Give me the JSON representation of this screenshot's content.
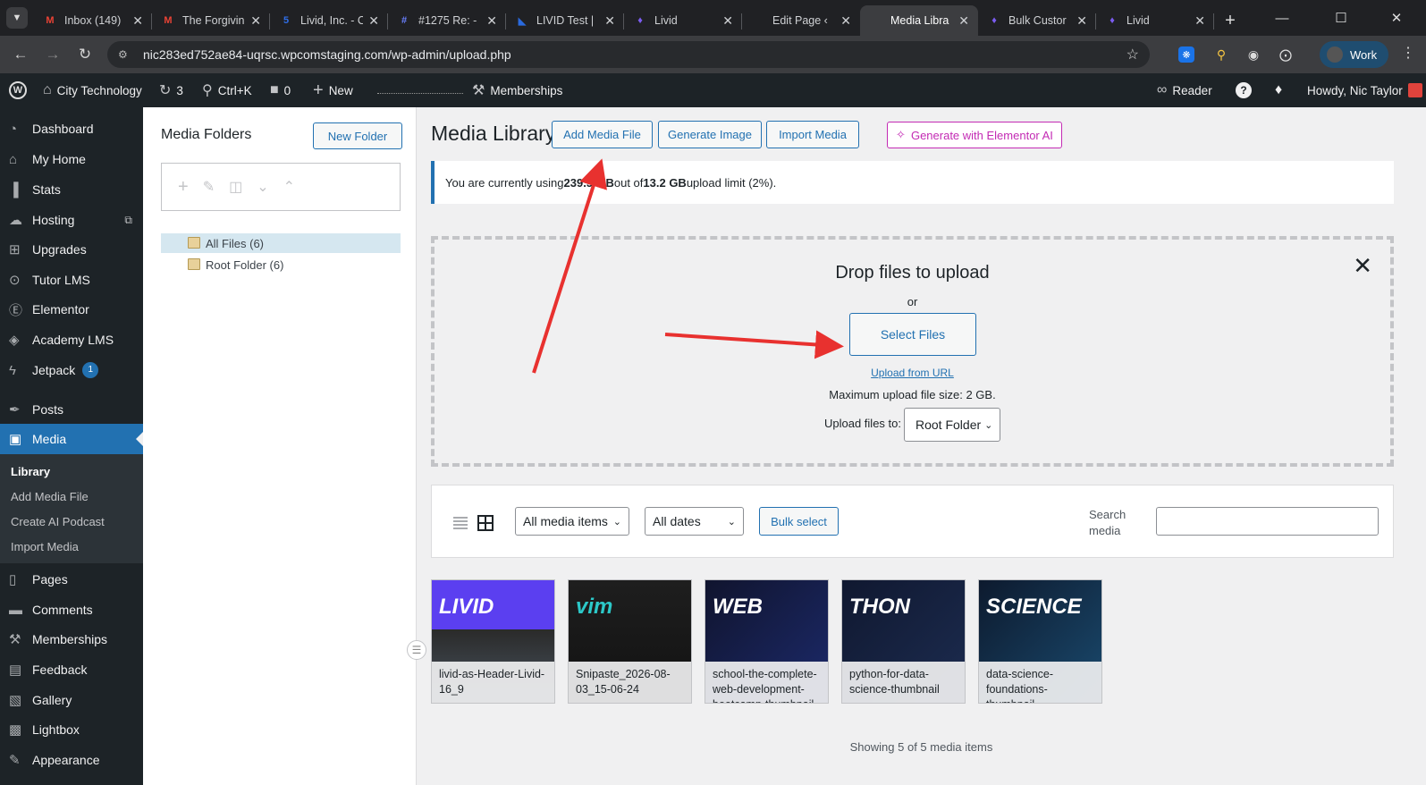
{
  "browser": {
    "tabs": [
      {
        "title": "Inbox (149)",
        "icon": "gmail-icon",
        "fav": "M",
        "fav_color": "#ea4335"
      },
      {
        "title": "The Forgivin",
        "icon": "gmail-icon",
        "fav": "M",
        "fav_color": "#ea4335"
      },
      {
        "title": "Livid, Inc. - C",
        "icon": "app-icon",
        "fav": "5",
        "fav_color": "#2f6ee8"
      },
      {
        "title": "#1275 Re: -",
        "icon": "hash-icon",
        "fav": "#",
        "fav_color": "#6a80ff"
      },
      {
        "title": "LIVID Test |",
        "icon": "app-icon",
        "fav": "◣",
        "fav_color": "#2a6ade"
      },
      {
        "title": "Livid",
        "icon": "flame-icon",
        "fav": "♦",
        "fav_color": "#7b5cf0"
      },
      {
        "title": "Edit Page ‹",
        "icon": "",
        "fav": "",
        "fav_color": "#202124"
      },
      {
        "title": "Media Libra",
        "icon": "",
        "fav": "",
        "fav_color": "#3c3d40"
      },
      {
        "title": "Bulk Custor",
        "icon": "flame-icon",
        "fav": "♦",
        "fav_color": "#7b5cf0"
      },
      {
        "title": "Livid",
        "icon": "flame-icon",
        "fav": "♦",
        "fav_color": "#7b5cf0"
      }
    ],
    "url": "nic283ed752ae84-uqrsc.wpcomstaging.com/wp-admin/upload.php",
    "profile": "Work"
  },
  "adminbar": {
    "site": "City Technology",
    "updates": "3",
    "search": "Ctrl+K",
    "comments": "0",
    "new": "New",
    "memberships": "Memberships",
    "reader": "Reader",
    "howdy": "Howdy, Nic Taylor"
  },
  "sidebar": {
    "items": [
      {
        "label": "Dashboard",
        "icon": "dashboard-icon",
        "glyph": "◔"
      },
      {
        "label": "My Home",
        "icon": "home-icon",
        "glyph": "⌂"
      },
      {
        "label": "Stats",
        "icon": "stats-icon",
        "glyph": "▐"
      },
      {
        "label": "Hosting",
        "icon": "cloud-icon",
        "glyph": "☁"
      },
      {
        "label": "Upgrades",
        "icon": "cart-icon",
        "glyph": "⊞"
      },
      {
        "label": "Tutor LMS",
        "icon": "tutor-icon",
        "glyph": "⊙"
      },
      {
        "label": "Elementor",
        "icon": "elementor-icon",
        "glyph": "Ⓔ"
      },
      {
        "label": "Academy LMS",
        "icon": "academy-icon",
        "glyph": "◈"
      },
      {
        "label": "Jetpack",
        "icon": "jetpack-icon",
        "glyph": "ϟ",
        "badge": "1"
      },
      {
        "label": "Posts",
        "icon": "pin-icon",
        "glyph": "✒"
      },
      {
        "label": "Media",
        "icon": "media-icon",
        "glyph": "▣"
      },
      {
        "label": "Pages",
        "icon": "pages-icon",
        "glyph": "▯"
      },
      {
        "label": "Comments",
        "icon": "comments-icon",
        "glyph": "▬"
      },
      {
        "label": "Memberships",
        "icon": "memberships-icon",
        "glyph": "⚒"
      },
      {
        "label": "Feedback",
        "icon": "feedback-icon",
        "glyph": "▤"
      },
      {
        "label": "Gallery",
        "icon": "gallery-icon",
        "glyph": "▧"
      },
      {
        "label": "Lightbox",
        "icon": "lightbox-icon",
        "glyph": "▩"
      },
      {
        "label": "Appearance",
        "icon": "appearance-icon",
        "glyph": "✎"
      }
    ],
    "submenu": [
      "Library",
      "Add Media File",
      "Create AI Podcast",
      "Import Media"
    ]
  },
  "folders": {
    "title": "Media Folders",
    "new_folder": "New Folder",
    "items": [
      "All Files (6)",
      "Root Folder (6)"
    ]
  },
  "main": {
    "title": "Media Library",
    "buttons": {
      "add": "Add Media File",
      "generate": "Generate Image",
      "import": "Import Media",
      "ai": "Generate with Elementor AI"
    },
    "notice": {
      "pre": "You are currently using ",
      "used": "239.5 MB",
      "mid": " out of ",
      "limit": "13.2 GB",
      "post": " upload limit (2%)."
    },
    "upload": {
      "title": "Drop files to upload",
      "or": "or",
      "select": "Select Files",
      "url": "Upload from URL",
      "max": "Maximum upload file size: 2 GB.",
      "to_label": "Upload files to:",
      "to_value": "Root Folder"
    },
    "filters": {
      "type": "All media items",
      "dates": "All dates",
      "bulk": "Bulk select",
      "search_label": "Search media"
    },
    "media": [
      {
        "name": "livid-as-Header-Livid-16_9"
      },
      {
        "name": "Snipaste_2026-08-03_15-06-24"
      },
      {
        "name": "school-the-complete-web-development-bootcamp-thumbnail"
      },
      {
        "name": "python-for-data-science-thumbnail"
      },
      {
        "name": "data-science-foundations-thumbnail"
      }
    ],
    "showing": "Showing 5 of 5 media items"
  },
  "colors": {
    "accent": "#2271b1",
    "ai": "#c32bb4",
    "annotation": "#e8312f"
  }
}
